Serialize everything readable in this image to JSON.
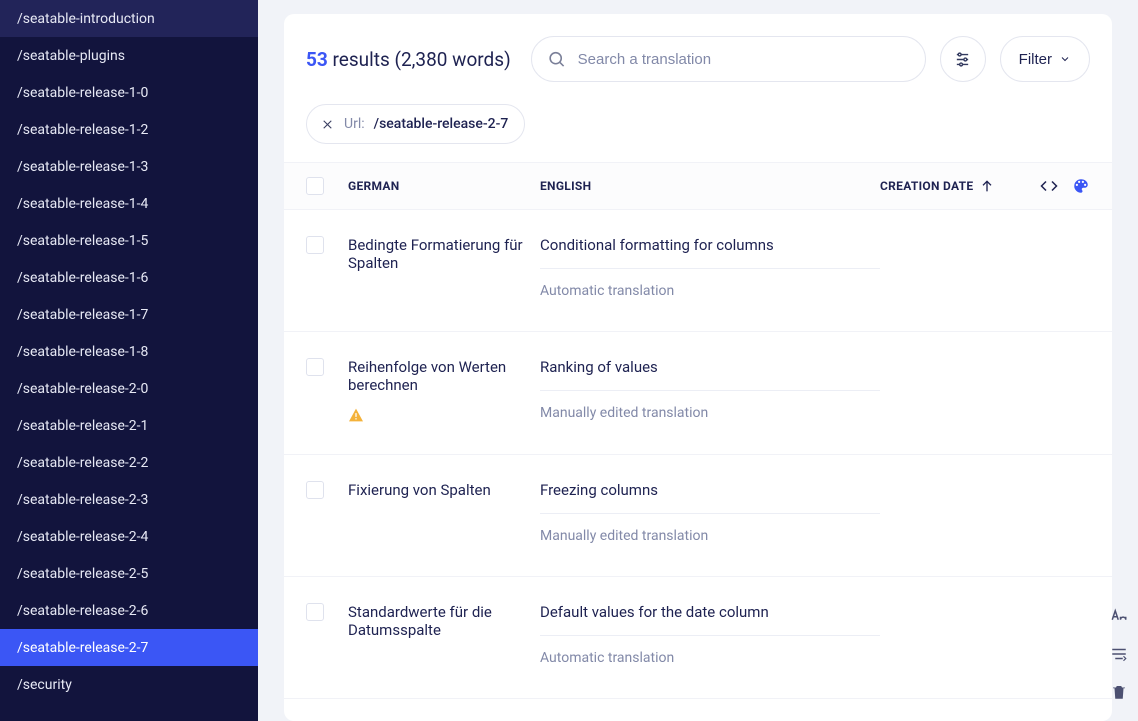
{
  "sidebar": {
    "items": [
      "/seatable-introduction",
      "/seatable-plugins",
      "/seatable-release-1-0",
      "/seatable-release-1-2",
      "/seatable-release-1-3",
      "/seatable-release-1-4",
      "/seatable-release-1-5",
      "/seatable-release-1-6",
      "/seatable-release-1-7",
      "/seatable-release-1-8",
      "/seatable-release-2-0",
      "/seatable-release-2-1",
      "/seatable-release-2-2",
      "/seatable-release-2-3",
      "/seatable-release-2-4",
      "/seatable-release-2-5",
      "/seatable-release-2-6",
      "/seatable-release-2-7",
      "/security"
    ],
    "active_index": 17
  },
  "results": {
    "count": "53",
    "results_word": " results ",
    "words": "(2,380 words)"
  },
  "search": {
    "placeholder": "Search a translation"
  },
  "filter": {
    "label": "Filter"
  },
  "chip": {
    "label": "Url: ",
    "value": "/seatable-release-2-7"
  },
  "columns": {
    "source": "GERMAN",
    "target": "ENGLISH",
    "date": "CREATION DATE"
  },
  "rows": [
    {
      "source": "Bedingte Formatierung für Spalten",
      "warning": false,
      "target": "Conditional formatting for columns",
      "status": "Automatic translation"
    },
    {
      "source": "Reihenfolge von Werten berechnen",
      "warning": true,
      "target": "Ranking of values",
      "status": "Manually edited translation"
    },
    {
      "source": "Fixierung von Spalten",
      "warning": false,
      "target": "Freezing columns",
      "status": "Manually edited translation"
    },
    {
      "source": "Standardwerte für die Datumsspalte",
      "warning": false,
      "target": "Default values for the date column",
      "status": "Automatic translation"
    }
  ]
}
